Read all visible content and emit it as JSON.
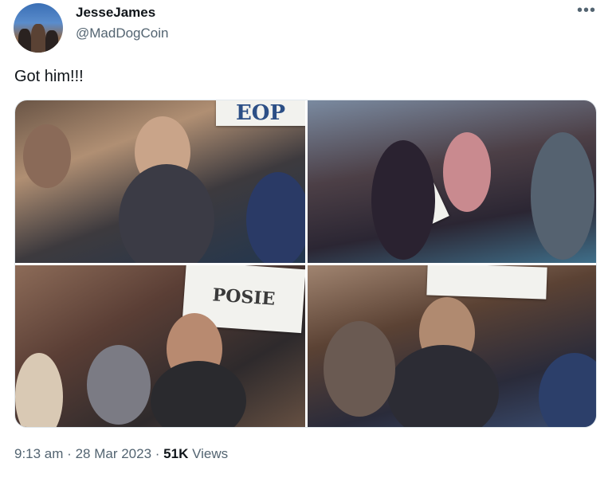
{
  "author": {
    "display_name": "JesseJames",
    "handle": "@MadDogCoin"
  },
  "menu": {
    "more_label": "•••"
  },
  "tweet": {
    "text": "Got him!!!"
  },
  "media": {
    "photos": [
      {
        "sign_text": "EOP"
      },
      {
        "sign_text": ""
      },
      {
        "sign_text": "POSIE"
      },
      {
        "sign_text": ""
      }
    ]
  },
  "meta": {
    "time": "9:13 am",
    "separator": "·",
    "date": "28 Mar 2023",
    "views_count": "51K",
    "views_label": "Views"
  },
  "colors": {
    "text_primary": "#0f1419",
    "text_secondary": "#536471"
  }
}
